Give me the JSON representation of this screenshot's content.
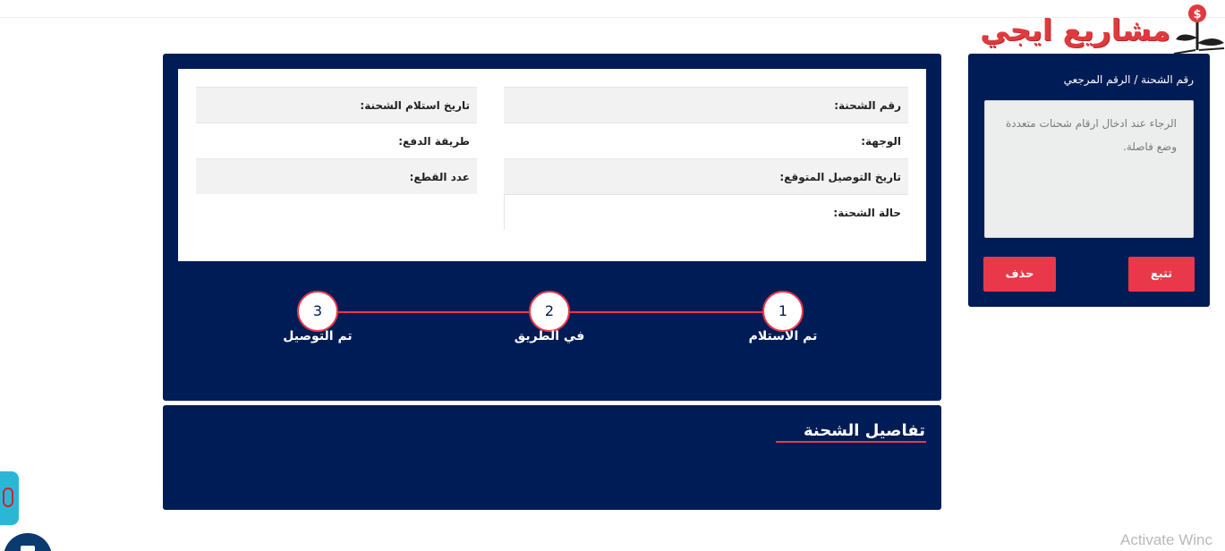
{
  "logo": {
    "text": "مشاريع ايجي"
  },
  "tracking": {
    "label": "رقم الشحنة / الرقم المرجعي",
    "placeholder": "الرجاء عند ادخال ارقام شحنات متعددة وضع فاصلة.",
    "track_button": "تتبع",
    "delete_button": "حذف"
  },
  "shipment_info": {
    "right_column": [
      "رقم الشحنة:",
      "الوجهة:",
      "تاريخ التوصيل المتوقع:",
      "حالة الشحنة:"
    ],
    "left_column": [
      "تاريخ استلام الشحنة:",
      "طريقة الدفع:",
      "عدد القطع:"
    ]
  },
  "steps": [
    {
      "number": "1",
      "label": "تم الاستلام"
    },
    {
      "number": "2",
      "label": "في الطريق"
    },
    {
      "number": "3",
      "label": "تم التوصيل"
    }
  ],
  "details": {
    "title": "تفاصيل الشحنة"
  },
  "watermark": "Activate Winc",
  "colors": {
    "navy": "#001c56",
    "accent_red": "#e8384a",
    "logo_red": "#e03a3e"
  }
}
